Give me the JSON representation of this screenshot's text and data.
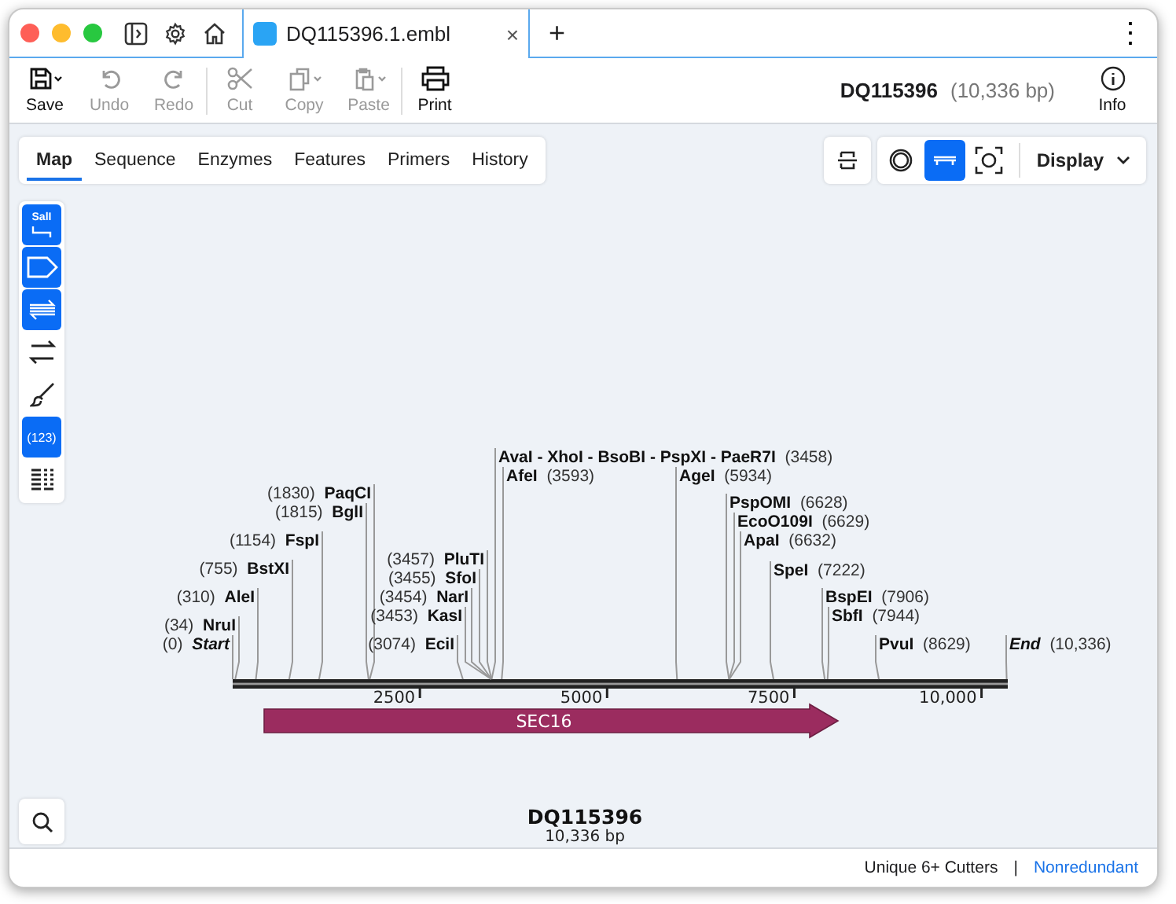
{
  "document_tab": {
    "title": "DQ115396.1.embl",
    "close_symbol": "×"
  },
  "new_tab_symbol": "+",
  "menu_symbol": "⋮",
  "toolbar": [
    {
      "kind": "save",
      "label": "Save",
      "disabled": false
    },
    {
      "kind": "undo",
      "label": "Undo",
      "disabled": true
    },
    {
      "kind": "redo",
      "label": "Redo",
      "disabled": true
    },
    {
      "kind": "cut",
      "label": "Cut",
      "disabled": true
    },
    {
      "kind": "copy",
      "label": "Copy",
      "disabled": true
    },
    {
      "kind": "paste",
      "label": "Paste",
      "disabled": true
    },
    {
      "kind": "print",
      "label": "Print",
      "disabled": false
    }
  ],
  "sequence_info": {
    "name": "DQ115396",
    "length": "(10,336 bp)"
  },
  "info_button": {
    "label": "Info"
  },
  "view_tabs": [
    {
      "label": "Map",
      "selected": true
    },
    {
      "label": "Sequence",
      "selected": false
    },
    {
      "label": "Enzymes",
      "selected": false
    },
    {
      "label": "Features",
      "selected": false
    },
    {
      "label": "Primers",
      "selected": false
    },
    {
      "label": "History",
      "selected": false
    }
  ],
  "view_buttons": [
    {
      "kind": "collapse",
      "selected": false
    },
    {
      "kind": "circular",
      "selected": false
    },
    {
      "kind": "linear",
      "selected": true
    },
    {
      "kind": "fit",
      "selected": false
    }
  ],
  "display_menu": {
    "label": "Display"
  },
  "side_tools": [
    {
      "kind": "sites",
      "label": "SalI",
      "selected": true
    },
    {
      "kind": "features",
      "selected": true
    },
    {
      "kind": "translations",
      "selected": true
    },
    {
      "kind": "orfs",
      "selected": false
    },
    {
      "kind": "colors",
      "selected": false
    },
    {
      "kind": "numbering",
      "label": "(123)",
      "selected": true
    },
    {
      "kind": "list",
      "selected": false
    }
  ],
  "map": {
    "title": "DQ115396",
    "subtitle": "10,336 bp",
    "sites": [
      {
        "kind": "enzyme",
        "name": "AvaI - XhoI - BsoBI - PspXI - PaeR7I",
        "position": "(3458)"
      },
      {
        "kind": "enzyme",
        "name": "AfeI",
        "position": "(3593)"
      },
      {
        "kind": "enzyme",
        "name": "AgeI",
        "position": "(5934)"
      },
      {
        "kind": "enzyme",
        "name": "PaqCI",
        "position": "(1830)"
      },
      {
        "kind": "enzyme",
        "name": "PspOMI",
        "position": "(6628)"
      },
      {
        "kind": "enzyme",
        "name": "BglI",
        "position": "(1815)"
      },
      {
        "kind": "enzyme",
        "name": "EcoO109I",
        "position": "(6629)"
      },
      {
        "kind": "enzyme",
        "name": "FspI",
        "position": "(1154)"
      },
      {
        "kind": "enzyme",
        "name": "ApaI",
        "position": "(6632)"
      },
      {
        "kind": "enzyme",
        "name": "PluTI",
        "position": "(3457)"
      },
      {
        "kind": "enzyme",
        "name": "BstXI",
        "position": "(755)"
      },
      {
        "kind": "enzyme",
        "name": "SfoI",
        "position": "(3455)"
      },
      {
        "kind": "enzyme",
        "name": "SpeI",
        "position": "(7222)"
      },
      {
        "kind": "enzyme",
        "name": "AleI",
        "position": "(310)"
      },
      {
        "kind": "enzyme",
        "name": "NarI",
        "position": "(3454)"
      },
      {
        "kind": "enzyme",
        "name": "BspEI",
        "position": "(7906)"
      },
      {
        "kind": "enzyme",
        "name": "KasI",
        "position": "(3453)"
      },
      {
        "kind": "enzyme",
        "name": "SbfI",
        "position": "(7944)"
      },
      {
        "kind": "enzyme",
        "name": "NruI",
        "position": "(34)"
      },
      {
        "kind": "terminus",
        "name": "Start",
        "position": "(0)"
      },
      {
        "kind": "enzyme",
        "name": "EciI",
        "position": "(3074)"
      },
      {
        "kind": "enzyme",
        "name": "PvuI",
        "position": "(8629)"
      },
      {
        "kind": "terminus",
        "name": "End",
        "position": "(10,336)"
      }
    ],
    "ticks": [
      "2500",
      "5000",
      "7500",
      "10,000"
    ],
    "features": [
      {
        "name": "SEC16"
      }
    ]
  },
  "status_bar": {
    "text": "Unique 6+ Cutters",
    "separator": "|",
    "link": "Nonredundant"
  }
}
